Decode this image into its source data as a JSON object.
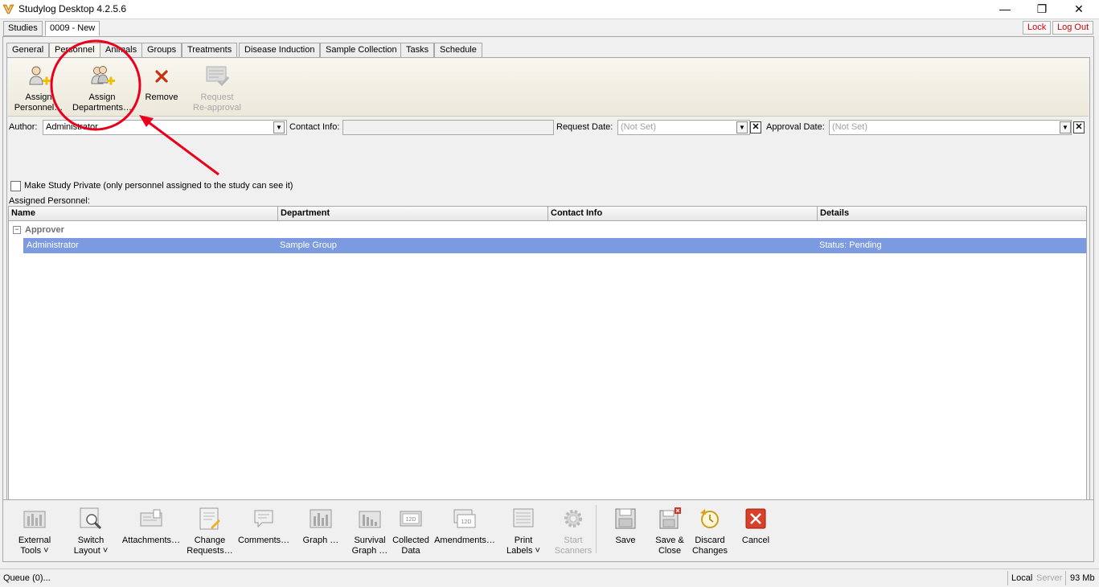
{
  "window": {
    "title": "Studylog Desktop 4.2.5.6",
    "minimize": "—",
    "restore": "❐",
    "close": "✕"
  },
  "top_tabs": [
    {
      "label": "Studies"
    },
    {
      "label": "0009 - New"
    }
  ],
  "header_buttons": {
    "lock": "Lock",
    "logout": "Log Out"
  },
  "sub_tabs": [
    {
      "label": "General"
    },
    {
      "label": "Personnel"
    },
    {
      "label": "Animals"
    },
    {
      "label": "Groups"
    },
    {
      "label": "Treatments"
    },
    {
      "label": "Disease Induction"
    },
    {
      "label": "Sample Collection"
    },
    {
      "label": "Tasks"
    },
    {
      "label": "Schedule"
    }
  ],
  "ribbon": {
    "assign_personnel": {
      "line1": "Assign",
      "line2": "Personnel…",
      "icon": "person-add-icon"
    },
    "assign_departments": {
      "line1": "Assign",
      "line2": "Departments…",
      "icon": "group-add-icon"
    },
    "remove": {
      "line1": "Remove",
      "icon": "remove-x-icon"
    },
    "request_reapproval": {
      "line1": "Request",
      "line2": "Re-approval",
      "icon": "approval-icon"
    }
  },
  "fields": {
    "author_label": "Author:",
    "author_value": "Administrator",
    "contact_label": "Contact Info:",
    "contact_value": "",
    "request_date_label": "Request Date:",
    "request_date_placeholder": "(Not Set)",
    "approval_date_label": "Approval Date:",
    "approval_date_placeholder": "(Not Set)"
  },
  "make_private": {
    "checked": false,
    "label": "Make Study Private (only personnel assigned to the study can see it)"
  },
  "assigned_label": "Assigned Personnel:",
  "grid": {
    "columns": [
      "Name",
      "Department",
      "Contact Info",
      "Details"
    ],
    "groups": [
      {
        "label": "Approver",
        "rows": [
          {
            "name": "Administrator",
            "department": "Sample Group",
            "contact": "",
            "details": "Status: Pending"
          }
        ]
      }
    ]
  },
  "bottom_toolbar": [
    {
      "line1": "External",
      "line2": "Tools ˅",
      "icon": "chart-tools-icon",
      "enabled": true
    },
    {
      "line1": "Switch",
      "line2": "Layout ˅",
      "icon": "magnifier-icon",
      "enabled": true
    },
    {
      "line1": "Attachments…",
      "line2": "",
      "icon": "attachment-icon",
      "enabled": true
    },
    {
      "line1": "Change",
      "line2": "Requests…",
      "icon": "change-request-icon",
      "enabled": true
    },
    {
      "line1": "Comments…",
      "line2": "",
      "icon": "comment-icon",
      "enabled": true
    },
    {
      "line1": "Graph …",
      "line2": "",
      "icon": "graph-icon",
      "enabled": true
    },
    {
      "line1": "Survival",
      "line2": "Graph …",
      "icon": "survival-graph-icon",
      "enabled": true
    },
    {
      "line1": "Collected",
      "line2": "Data",
      "icon": "collected-data-icon",
      "enabled": true
    },
    {
      "line1": "Amendments…",
      "line2": "",
      "icon": "amendments-icon",
      "enabled": true
    },
    {
      "line1": "Print",
      "line2": "Labels ˅",
      "icon": "print-labels-icon",
      "enabled": true
    },
    {
      "line1": "Start",
      "line2": "Scanners",
      "icon": "gear-icon",
      "enabled": false
    },
    {
      "line1": "Save",
      "line2": "",
      "icon": "save-icon",
      "enabled": true
    },
    {
      "line1": "Save &",
      "line2": "Close",
      "icon": "save-close-icon",
      "enabled": true
    },
    {
      "line1": "Discard",
      "line2": "Changes",
      "icon": "discard-icon",
      "enabled": true
    },
    {
      "line1": "Cancel",
      "line2": "",
      "icon": "cancel-icon",
      "enabled": true
    }
  ],
  "status_bar": {
    "queue": "Queue (0)...",
    "local": "Local",
    "server": "Server",
    "memory": "93 Mb"
  },
  "colors": {
    "selection": "#7b9ae0",
    "annotation": "#e8001c",
    "danger_text": "#d00000"
  }
}
